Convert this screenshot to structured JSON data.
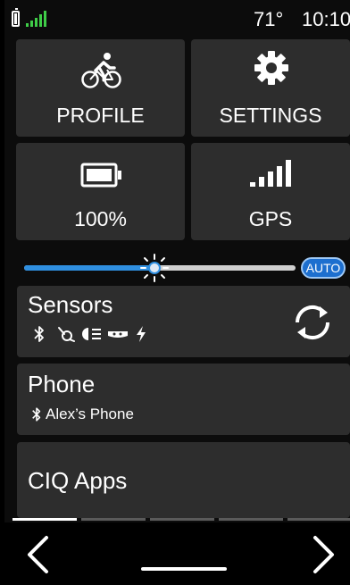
{
  "status_bar": {
    "temperature": "71°",
    "time": "10:10"
  },
  "tiles": {
    "profile": {
      "label": "PROFILE",
      "icon": "bicycle-rider-icon"
    },
    "settings": {
      "label": "SETTINGS",
      "icon": "gear-icon"
    },
    "battery": {
      "label": "100%",
      "icon": "battery-icon",
      "level": 1.0
    },
    "gps": {
      "label": "GPS",
      "icon": "signal-bars-icon"
    }
  },
  "brightness": {
    "level": 0.48,
    "auto_label": "AUTO"
  },
  "sensors": {
    "title": "Sensors",
    "icons": [
      "bluetooth-icon",
      "speed-sensor-icon",
      "light-icon",
      "radar-icon",
      "power-icon"
    ]
  },
  "phone": {
    "title": "Phone",
    "device_name": "Alex’s Phone"
  },
  "ciq_apps": {
    "title": "CIQ Apps"
  },
  "pager": {
    "pages": 5,
    "active_index": 0
  },
  "colors": {
    "accent": "#2f8fe0",
    "signal": "#3fcd48",
    "tile_bg": "#2d2d2d"
  }
}
